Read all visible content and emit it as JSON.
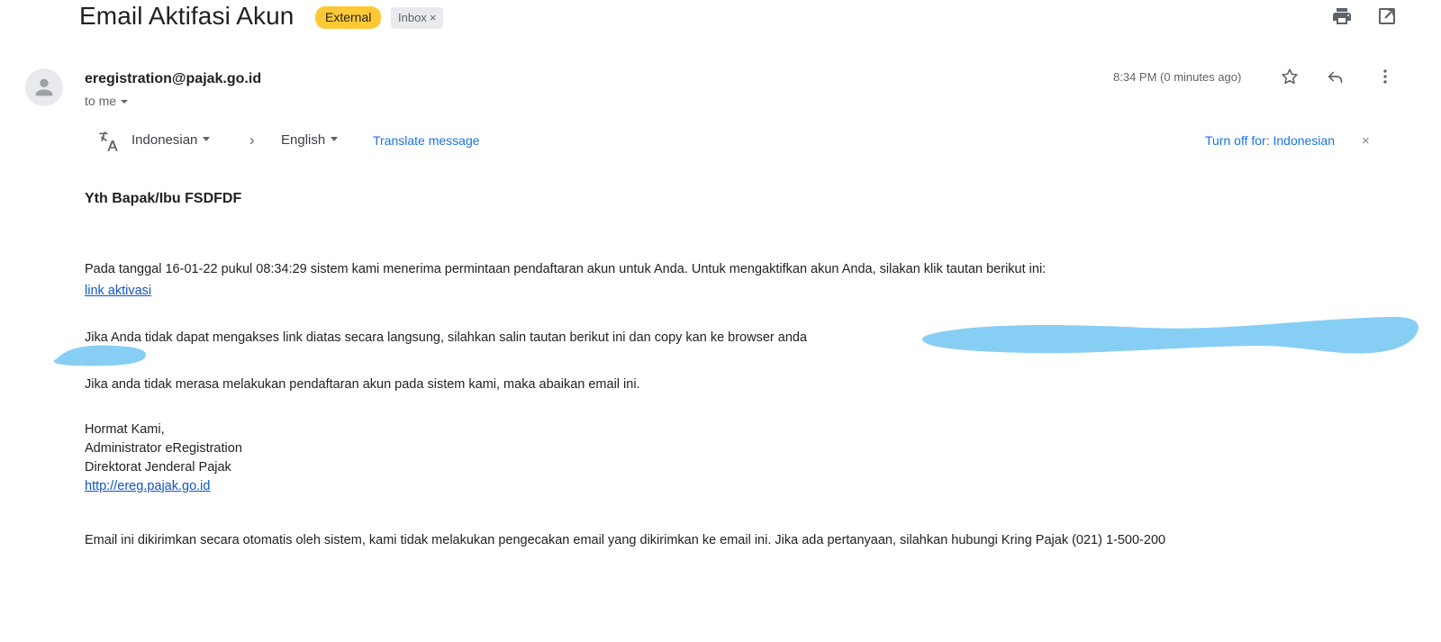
{
  "header": {
    "subject": "Email Aktifasi Akun",
    "external_badge": "External",
    "inbox_chip": "Inbox",
    "inbox_chip_close": "×",
    "print_icon": "print-icon",
    "popout_icon": "open-in-new-window-icon"
  },
  "message": {
    "sender": "eregistration@pajak.go.id",
    "recipient": "to me",
    "timestamp": "8:34 PM (0 minutes ago)",
    "star_icon": "star-icon",
    "reply_icon": "reply-icon",
    "more_icon": "more-options-icon",
    "avatar_icon": "person-avatar-icon"
  },
  "translate": {
    "icon": "translate-icon",
    "source_language": "Indonesian",
    "arrow": "›",
    "target_language": "English",
    "translate_action": "Translate message",
    "turn_off": "Turn off for: Indonesian",
    "close": "×"
  },
  "body": {
    "greeting": "Yth Bapak/Ibu FSDFDF",
    "paragraph_1": "Pada tanggal 16-01-22 pukul 08:34:29 sistem kami menerima permintaan pendaftaran akun untuk Anda. Untuk mengaktifkan akun Anda, silakan klik tautan berikut ini:",
    "activation_link": "link aktivasi",
    "paragraph_2": "Jika Anda tidak dapat mengakses link diatas secara langsung, silahkan salin tautan berikut ini dan copy kan ke browser anda",
    "paragraph_3": "Jika anda tidak merasa melakukan pendaftaran akun pada sistem kami, maka abaikan email ini.",
    "signature_1": "Hormat Kami,",
    "signature_2": "Administrator eRegistration",
    "signature_3": "Direktorat Jenderal Pajak",
    "signature_link": "http://ereg.pajak.go.id",
    "paragraph_4": "Email ini dikirimkan secara otomatis oleh sistem, kami tidak melakukan pengecakan email yang dikirimkan ke email ini. Jika ada pertanyaan, silahkan hubungi Kring Pajak (021) 1-500-200"
  },
  "annotations": {
    "highlight_color": "#87cef5",
    "marks": [
      "scribble-over-url-right",
      "scribble-left-margin"
    ]
  },
  "colors": {
    "badge_yellow": "#fcc934",
    "link_blue": "#1155cc",
    "action_blue": "#1a73e8",
    "text_primary": "#202124",
    "text_secondary": "#5f6368",
    "chip_grey": "#e8eaed"
  }
}
